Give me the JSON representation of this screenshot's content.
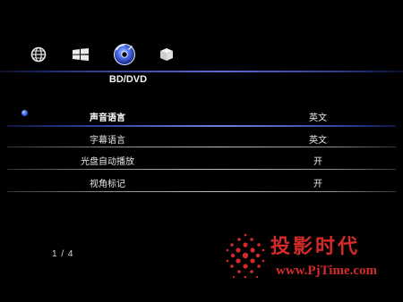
{
  "header": {
    "tabs": [
      {
        "icon": "globe-icon"
      },
      {
        "icon": "windows-icon"
      },
      {
        "icon": "disc-icon",
        "active": true
      },
      {
        "icon": "cube-icon"
      }
    ],
    "title": "BD/DVD"
  },
  "settings": {
    "rows": [
      {
        "label": "声音语言",
        "value": "英文",
        "selected": true
      },
      {
        "label": "字幕语言",
        "value": "英文"
      },
      {
        "label": "光盘自动播放",
        "value": "开"
      },
      {
        "label": "视角标记",
        "value": "开"
      }
    ]
  },
  "footer": {
    "page_indicator": "1 / 4"
  },
  "watermark": {
    "chinese": "投影时代",
    "english": "www.PjTime.com"
  },
  "colors": {
    "background": "#000000",
    "accent_blue": "#4a66d8",
    "watermark_red": "#d62a2a"
  }
}
